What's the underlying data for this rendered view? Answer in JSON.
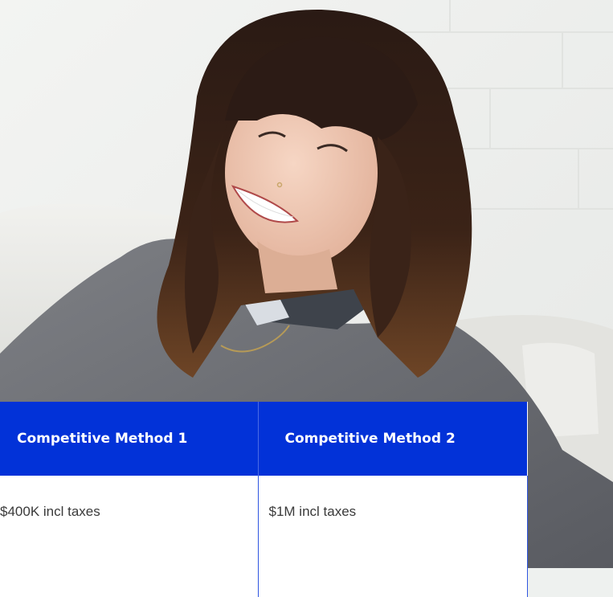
{
  "table": {
    "headers": [
      "Competitive Method 1",
      "Competitive Method 2"
    ],
    "rows": [
      [
        "$400K incl taxes",
        "$1M incl taxes"
      ]
    ]
  },
  "colors": {
    "header_background": "#0232d8",
    "header_text": "#ffffff",
    "cell_background": "#ffffff",
    "cell_text": "#3a3a3a"
  }
}
